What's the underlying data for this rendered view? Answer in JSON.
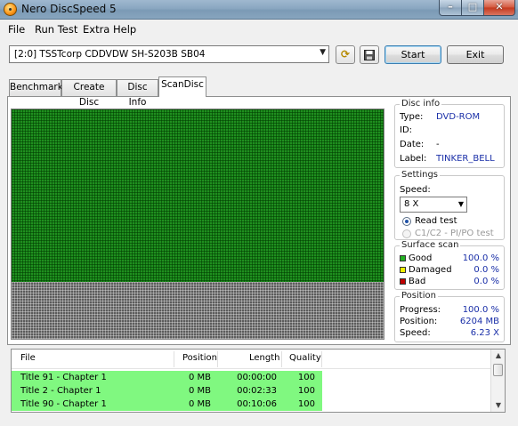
{
  "window": {
    "title": "Nero DiscSpeed 5",
    "minimize": "–",
    "maximize": "□",
    "close": "✕"
  },
  "menu": [
    "File",
    "Run Test",
    "Extra",
    "Help"
  ],
  "toolbar": {
    "drive": "[2:0]  TSSTcorp CDDVDW SH-S203B SB04",
    "refresh_icon": "refresh-icon",
    "save_icon": "save-icon",
    "start_label": "Start",
    "exit_label": "Exit"
  },
  "tabs": [
    "Benchmark",
    "Create Disc",
    "Disc Info",
    "ScanDisc"
  ],
  "active_tab": "ScanDisc",
  "disc_info": {
    "title": "Disc info",
    "type_label": "Type:",
    "type_value": "DVD-ROM",
    "id_label": "ID:",
    "id_value": "",
    "date_label": "Date:",
    "date_value": "-",
    "label_label": "Label:",
    "label_value": "TINKER_BELL"
  },
  "settings": {
    "title": "Settings",
    "speed_label": "Speed:",
    "speed_value": "8 X",
    "read_test": "Read test",
    "c1c2_test": "C1/C2 - PI/PO test"
  },
  "surface_scan": {
    "title": "Surface scan",
    "good_label": "Good",
    "good_value": "100.0 %",
    "damaged_label": "Damaged",
    "damaged_value": "0.0 %",
    "bad_label": "Bad",
    "bad_value": "0.0 %",
    "colors": {
      "good": "#22b022",
      "damaged": "#f0f000",
      "bad": "#c00000"
    }
  },
  "position": {
    "title": "Position",
    "progress_label": "Progress:",
    "progress_value": "100.0 %",
    "position_label": "Position:",
    "position_value": "6204 MB",
    "speed_label": "Speed:",
    "speed_value": "6.23 X"
  },
  "scan_map": {
    "scanned_fraction": 0.75,
    "color_good": "#1f8f1f",
    "color_unscanned": "#5c5c5c"
  },
  "file_list": {
    "columns": [
      "File",
      "Position",
      "Length",
      "Quality"
    ],
    "rows": [
      {
        "file": "Title 91 - Chapter 1",
        "position": "0 MB",
        "length": "00:00:00",
        "quality": "100"
      },
      {
        "file": "Title 2 - Chapter 1",
        "position": "0 MB",
        "length": "00:02:33",
        "quality": "100"
      },
      {
        "file": "Title 90 - Chapter 1",
        "position": "0 MB",
        "length": "00:10:06",
        "quality": "100"
      }
    ]
  }
}
